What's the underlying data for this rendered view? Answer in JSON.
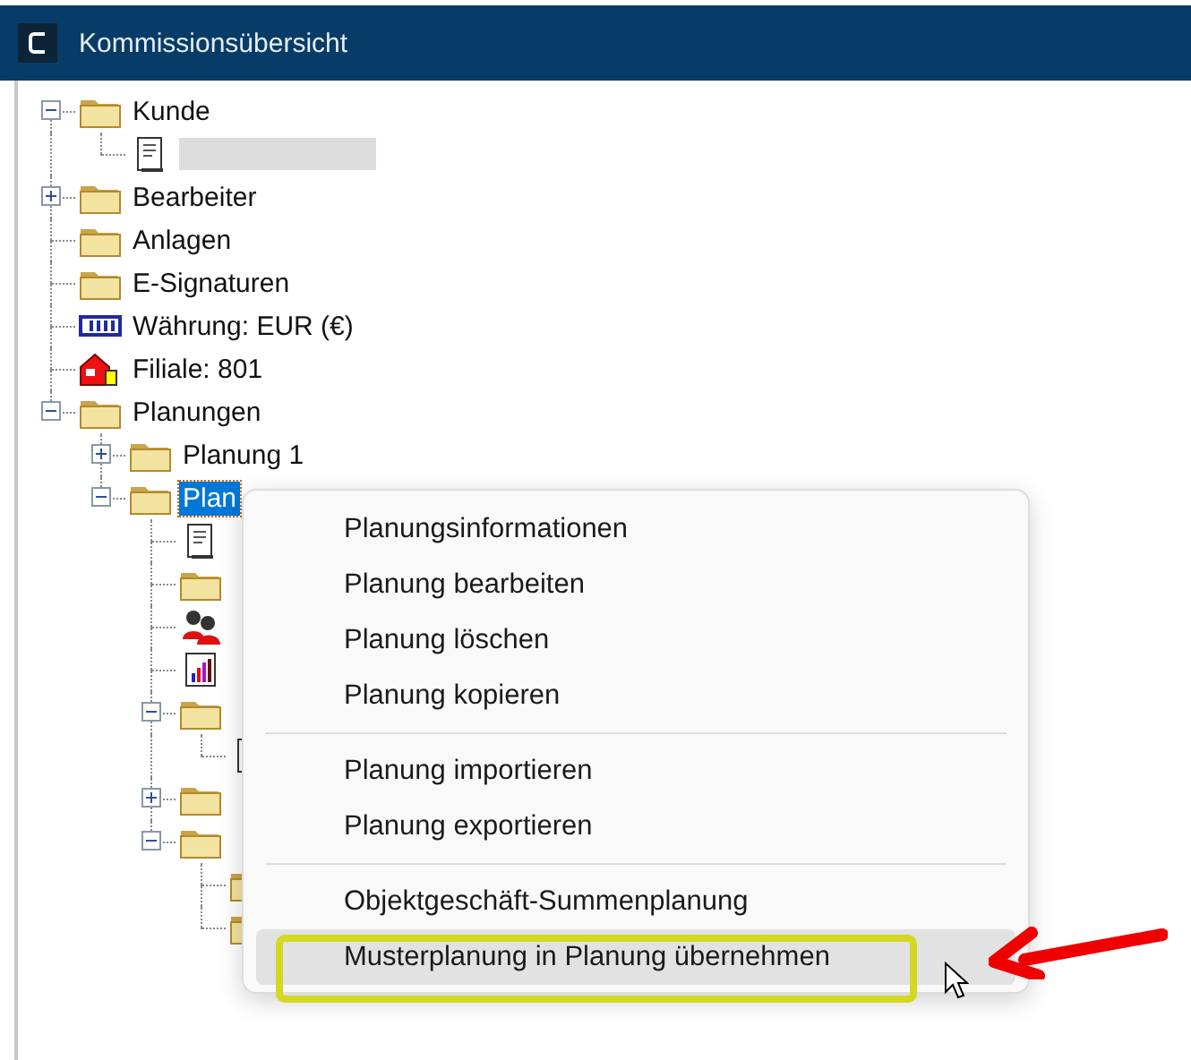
{
  "window": {
    "title": "Kommissionsübersicht"
  },
  "tree": [
    {
      "label": "Kunde",
      "kind": "folder",
      "expanded": true,
      "children": [
        {
          "kind": "document",
          "redacted": true
        }
      ]
    },
    {
      "label": "Bearbeiter",
      "kind": "folder",
      "expanded": false
    },
    {
      "label": "Anlagen",
      "kind": "folder"
    },
    {
      "label": "E-Signaturen",
      "kind": "folder"
    },
    {
      "label": "Währung: EUR (€)",
      "kind": "currency"
    },
    {
      "label": "Filiale: 801",
      "kind": "branch"
    },
    {
      "label": "Planungen",
      "kind": "folder",
      "expanded": true,
      "children": [
        {
          "label": "Planung 1",
          "kind": "folder",
          "expanded": false,
          "selected": false
        },
        {
          "label": "Plan",
          "kind": "folder",
          "expanded": true,
          "selected": true,
          "children": [
            {
              "kind": "document"
            },
            {
              "kind": "folder"
            },
            {
              "kind": "people"
            },
            {
              "kind": "chart"
            },
            {
              "kind": "folder",
              "expanded": true,
              "children": [
                {
                  "kind": "document"
                }
              ]
            },
            {
              "kind": "folder",
              "expanded": false
            },
            {
              "kind": "folder",
              "expanded": true,
              "children": [
                {
                  "kind": "folder"
                },
                {
                  "kind": "folder"
                }
              ]
            }
          ]
        }
      ]
    }
  ],
  "context_menu": {
    "groups": [
      [
        {
          "label": "Planungsinformationen",
          "highlighted": false
        },
        {
          "label": "Planung bearbeiten",
          "highlighted": false
        },
        {
          "label": "Planung löschen",
          "highlighted": false
        },
        {
          "label": "Planung kopieren",
          "highlighted": false
        }
      ],
      [
        {
          "label": "Planung importieren",
          "highlighted": false
        },
        {
          "label": "Planung exportieren",
          "highlighted": false
        }
      ],
      [
        {
          "label": "Objektgeschäft-Summenplanung",
          "highlighted": false
        },
        {
          "label": "Musterplanung in Planung übernehmen",
          "highlighted": true
        }
      ]
    ]
  }
}
